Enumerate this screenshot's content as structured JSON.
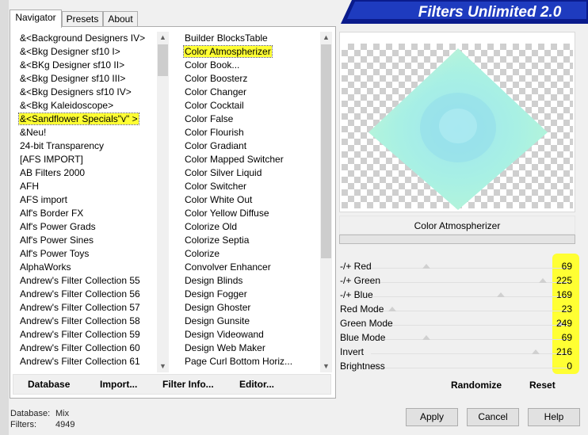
{
  "title": "Filters Unlimited 2.0",
  "tabs": [
    {
      "label": "Navigator",
      "active": true
    },
    {
      "label": "Presets",
      "active": false
    },
    {
      "label": "About",
      "active": false
    }
  ],
  "categories": [
    "&<Background Designers IV>",
    "&<Bkg Designer sf10 I>",
    "&<BKg Designer sf10 II>",
    "&<Bkg Designer sf10 III>",
    "&<Bkg Designers sf10 IV>",
    "&<Bkg Kaleidoscope>",
    "&<Sandflower Specials\"v\" >",
    "&Neu!",
    "24-bit Transparency",
    "[AFS IMPORT]",
    "AB Filters 2000",
    "AFH",
    "AFS import",
    "Alf's Border FX",
    "Alf's Power Grads",
    "Alf's Power Sines",
    "Alf's Power Toys",
    "AlphaWorks",
    "Andrew's Filter Collection 55",
    "Andrew's Filter Collection 56",
    "Andrew's Filter Collection 57",
    "Andrew's Filter Collection 58",
    "Andrew's Filter Collection 59",
    "Andrew's Filter Collection 60",
    "Andrew's Filter Collection 61"
  ],
  "selected_category_index": 6,
  "filters": [
    "Builder BlocksTable",
    "Color Atmospherizer",
    "Color Book...",
    "Color Boosterz",
    "Color Changer",
    "Color Cocktail",
    "Color False",
    "Color Flourish",
    "Color Gradiant",
    "Color Mapped Switcher",
    "Color Silver Liquid",
    "Color Switcher",
    "Color White Out",
    "Color Yellow Diffuse",
    "Colorize Old",
    "Colorize Septia",
    "Colorize",
    "Convolver Enhancer",
    "Design Blinds",
    "Design Fogger",
    "Design Ghoster",
    "Design Gunsite",
    "Design Videowand",
    "Design Web Maker",
    "Page Curl Bottom Horiz..."
  ],
  "selected_filter_index": 1,
  "toolbar": {
    "database": "Database",
    "import": "Import...",
    "filter_info": "Filter Info...",
    "editor": "Editor..."
  },
  "preview": {
    "filter_name": "Color Atmospherizer"
  },
  "sliders": [
    {
      "label": "-/+ Red",
      "value": 69
    },
    {
      "label": "-/+ Green",
      "value": 225
    },
    {
      "label": "-/+ Blue",
      "value": 169
    },
    {
      "label": "Red Mode",
      "value": 23
    },
    {
      "label": "Green Mode",
      "value": 249
    },
    {
      "label": "Blue Mode",
      "value": 69
    },
    {
      "label": "Invert",
      "value": 216
    },
    {
      "label": "Brightness",
      "value": 0
    }
  ],
  "randomize": "Randomize",
  "reset": "Reset",
  "footer": {
    "database_label": "Database:",
    "database_value": "Mix",
    "filters_label": "Filters:",
    "filters_value": "4949"
  },
  "buttons": {
    "apply": "Apply",
    "cancel": "Cancel",
    "help": "Help"
  },
  "colors": {
    "highlight": "#ffff33",
    "banner": "#1a2fa0"
  }
}
